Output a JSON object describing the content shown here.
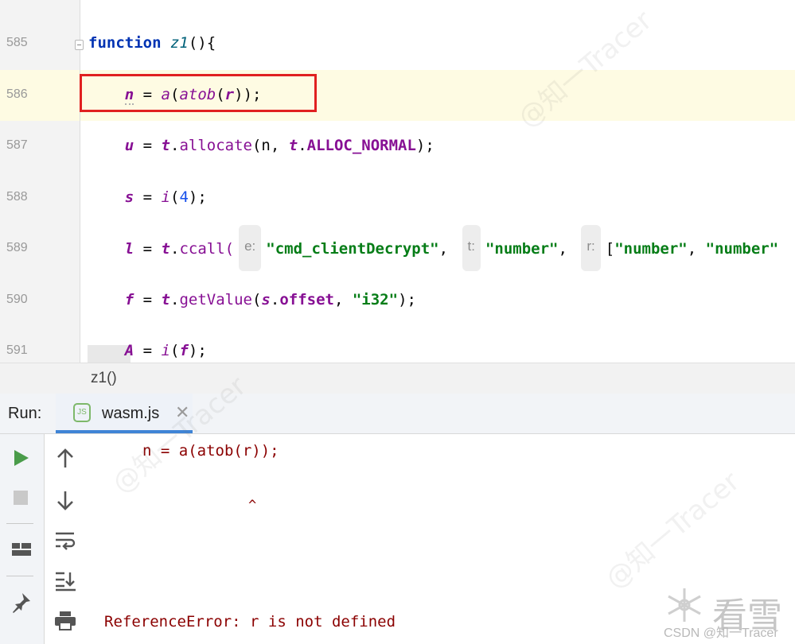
{
  "editor": {
    "lines": [
      {
        "num": "585"
      },
      {
        "num": "586"
      },
      {
        "num": "587"
      },
      {
        "num": "588"
      },
      {
        "num": "589"
      },
      {
        "num": "590"
      },
      {
        "num": "591"
      }
    ],
    "code": {
      "l585": {
        "kw": "function",
        "fn": "z1",
        "rest": "(){"
      },
      "l586": {
        "a": "n",
        "b": " = ",
        "c": "a",
        "d": "(",
        "e": "atob",
        "f": "(",
        "g": "r",
        "h": "));"
      },
      "l587": {
        "a": "u",
        "b": " = ",
        "c": "t",
        "d": ".",
        "e": "allocate",
        "f": "(n, ",
        "g": "t",
        "h": ".",
        "i": "ALLOC_NORMAL",
        "j": ");"
      },
      "l588": {
        "a": "s",
        "b": " = ",
        "c": "i",
        "d": "(",
        "e": "4",
        "f": ");"
      },
      "l589": {
        "a": "l",
        "b": " = ",
        "c": "t",
        "d": ".",
        "e": "ccall(",
        "hint_e": "e:",
        "s1": "\"cmd_clientDecrypt\"",
        "comma1": ", ",
        "hint_t": "t:",
        "s2": "\"number\"",
        "comma2": ", ",
        "hint_r": "r:",
        "br": "[",
        "s3": "\"number\"",
        "comma3": ", ",
        "s4": "\"number\""
      },
      "l590": {
        "a": "f",
        "b": " = ",
        "c": "t",
        "d": ".",
        "e": "getValue",
        "f": "(",
        "g": "s",
        "h": ".",
        "i": "offset",
        "j": ", ",
        "k": "\"i32\"",
        "l": ");"
      },
      "l591": {
        "a": "A",
        "b": " = ",
        "c": "i",
        "d": "(",
        "e": "f",
        "f": ");"
      }
    }
  },
  "breadcrumb": {
    "text": "z1()"
  },
  "run": {
    "label": "Run:",
    "tab": {
      "label": "wasm.js",
      "icon_text": "JS"
    },
    "console": {
      "line1": "n = a(atob(r));",
      "caret": "^",
      "error": "ReferenceError: r is not defined"
    }
  },
  "icons": {
    "run": "play-icon",
    "stop": "stop-icon",
    "up": "arrow-up-icon",
    "down": "arrow-down-icon",
    "layout": "layout-icon",
    "wrap": "soft-wrap-icon",
    "scroll_end": "scroll-to-end-icon",
    "pin": "pin-icon",
    "print": "print-icon"
  },
  "watermark": {
    "zhihu": "@知一Tracer",
    "kanxue": "看雪",
    "csdn": "CSDN @知一Tracer"
  },
  "colors": {
    "keyword": "#0033b3",
    "string": "#067d17",
    "variable": "#871094",
    "number": "#1750eb",
    "error": "#8b0000",
    "highlight_box": "#e02020",
    "run_green": "#4a9c4a",
    "tab_underline": "#3f84d6"
  }
}
